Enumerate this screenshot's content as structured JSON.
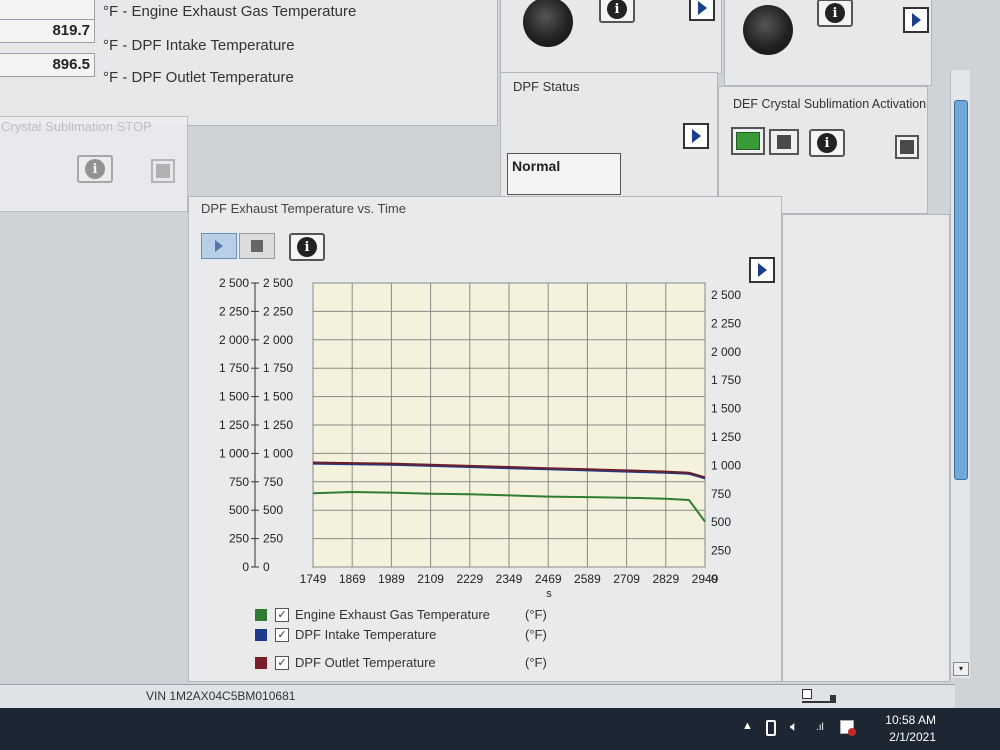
{
  "readouts": [
    {
      "value": "",
      "label": "°F - Engine Exhaust Gas Temperature"
    },
    {
      "value": "819.7",
      "label": "°F - DPF Intake Temperature"
    },
    {
      "value": "896.5",
      "label": "°F - DPF Outlet Temperature"
    }
  ],
  "panels": {
    "crystal_stop_title": "Crystal Sublimation STOP",
    "dpf_status_title": "DPF Status",
    "dpf_status_value": "Normal",
    "def_activation_title": "DEF Crystal Sublimation Activation",
    "graph_title": "DPF Exhaust Temperature vs. Time"
  },
  "chart_data": {
    "type": "line",
    "x": [
      1749,
      1869,
      1989,
      2109,
      2229,
      2349,
      2469,
      2589,
      2709,
      2829,
      2949
    ],
    "x_tick_labels": [
      "1749",
      "1869",
      "1989",
      "2109",
      "2229",
      "2349",
      "2469",
      "2589",
      "2709",
      "2829",
      "2949"
    ],
    "xlabel": "s",
    "xlim": [
      1749,
      2949
    ],
    "ylim": [
      0,
      2500
    ],
    "y_tick_labels": [
      "0",
      "250",
      "500",
      "750",
      "1 000",
      "1 250",
      "1 500",
      "1 750",
      "2 000",
      "2 250",
      "2 500"
    ],
    "grid": true,
    "series": [
      {
        "name": "Engine Exhaust Gas Temperature",
        "color": "#2e7d32",
        "points": [
          [
            1749,
            650
          ],
          [
            1869,
            660
          ],
          [
            1989,
            655
          ],
          [
            2109,
            645
          ],
          [
            2229,
            640
          ],
          [
            2349,
            630
          ],
          [
            2469,
            620
          ],
          [
            2589,
            615
          ],
          [
            2709,
            610
          ],
          [
            2829,
            600
          ],
          [
            2900,
            590
          ],
          [
            2949,
            400
          ]
        ]
      },
      {
        "name": "DPF Intake Temperature",
        "color": "#1e3a8a",
        "points": [
          [
            1749,
            910
          ],
          [
            1869,
            905
          ],
          [
            1989,
            900
          ],
          [
            2109,
            890
          ],
          [
            2229,
            880
          ],
          [
            2349,
            870
          ],
          [
            2469,
            860
          ],
          [
            2589,
            850
          ],
          [
            2709,
            840
          ],
          [
            2829,
            830
          ],
          [
            2900,
            820
          ],
          [
            2949,
            780
          ]
        ]
      },
      {
        "name": "DPF Outlet Temperature",
        "color": "#6b1f2a",
        "points": [
          [
            1749,
            920
          ],
          [
            1869,
            915
          ],
          [
            1989,
            910
          ],
          [
            2109,
            900
          ],
          [
            2229,
            890
          ],
          [
            2349,
            880
          ],
          [
            2469,
            870
          ],
          [
            2589,
            860
          ],
          [
            2709,
            850
          ],
          [
            2829,
            840
          ],
          [
            2900,
            830
          ],
          [
            2949,
            790
          ]
        ]
      }
    ],
    "legend": [
      {
        "label": "Engine Exhaust Gas Temperature",
        "unit": "(°F)",
        "color": "#2e7d32"
      },
      {
        "label": "DPF Intake Temperature",
        "unit": "(°F)",
        "color": "#1e3a8a"
      },
      {
        "label": "DPF Outlet Temperature",
        "unit": "(°F)",
        "color": "#7a1f2a"
      }
    ]
  },
  "statusbar": {
    "vin": "VIN 1M2AX04C5BM010681"
  },
  "taskbar": {
    "time": "10:58 AM",
    "date": "2/1/2021"
  },
  "colors": {
    "plot_bg": "#f4f2dc",
    "grid": "#8a8a8a",
    "def_active": "#3a9a3a"
  }
}
